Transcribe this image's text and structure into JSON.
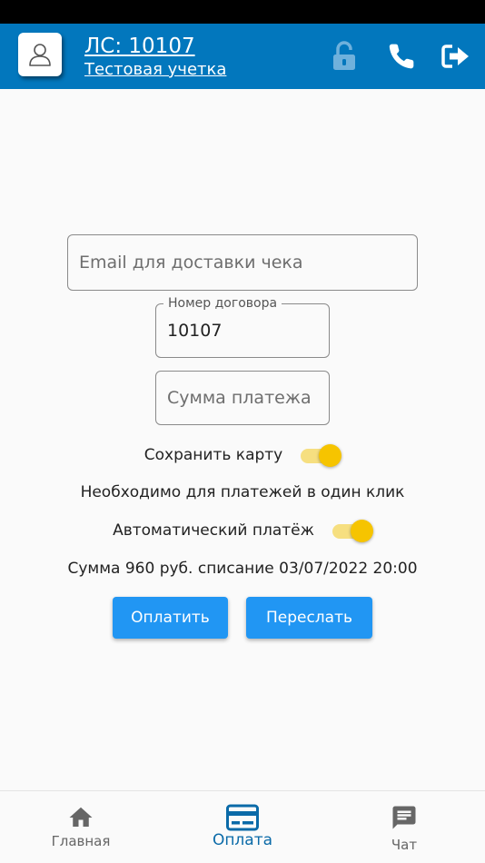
{
  "header": {
    "account_number": "ЛС: 10107",
    "account_name": "Тестовая учетка",
    "icons": [
      "user-icon",
      "lock-open-icon",
      "phone-icon",
      "logout-icon"
    ],
    "color": "#0277bd"
  },
  "form": {
    "email": {
      "placeholder": "Email для доставки чека",
      "value": ""
    },
    "contract": {
      "label": "Номер договора",
      "value": "10107"
    },
    "amount": {
      "placeholder": "Сумма платежа",
      "value": ""
    },
    "save_card": {
      "label": "Сохранить карту",
      "checked": true
    },
    "one_click_note": "Необходимо для платежей в один клик",
    "autopay": {
      "label": "Автоматический платёж",
      "checked": true
    },
    "schedule_note": "Сумма 960 руб. списание 03/07/2022 20:00",
    "pay_button": "Оплатить",
    "forward_button": "Переслать",
    "button_color": "#2196f3",
    "toggle_color": "#f6c400"
  },
  "bottom_nav": {
    "items": [
      {
        "label": "Главная",
        "icon": "home-icon",
        "active": false
      },
      {
        "label": "Оплата",
        "icon": "credit-card-icon",
        "active": true
      },
      {
        "label": "Чат",
        "icon": "chat-icon",
        "active": false
      }
    ],
    "active_color": "#0a6aa8"
  }
}
